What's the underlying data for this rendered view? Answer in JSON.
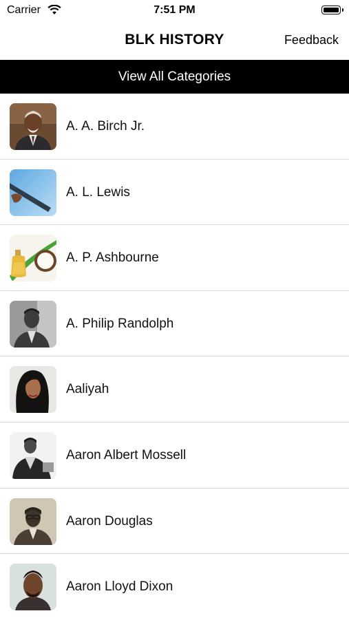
{
  "status_bar": {
    "carrier": "Carrier",
    "time": "7:51 PM",
    "wifi_icon": "wifi-icon",
    "battery_icon": "battery-icon"
  },
  "nav": {
    "title": "BLK HISTORY",
    "right_button": "Feedback"
  },
  "categories_button": "View All Categories",
  "list": {
    "items": [
      {
        "name": "A. A. Birch Jr.",
        "thumbnail": "portrait-photo"
      },
      {
        "name": "A. L. Lewis",
        "thumbnail": "window-squeegee-photo"
      },
      {
        "name": "A. P. Ashbourne",
        "thumbnail": "coconut-oil-photo"
      },
      {
        "name": "A. Philip Randolph",
        "thumbnail": "portrait-photo-bw"
      },
      {
        "name": "Aaliyah",
        "thumbnail": "portrait-photo"
      },
      {
        "name": "Aaron Albert Mossell",
        "thumbnail": "portrait-photo-bw"
      },
      {
        "name": "Aaron Douglas",
        "thumbnail": "portrait-photo-sepia"
      },
      {
        "name": "Aaron Lloyd Dixon",
        "thumbnail": "portrait-photo"
      }
    ]
  }
}
